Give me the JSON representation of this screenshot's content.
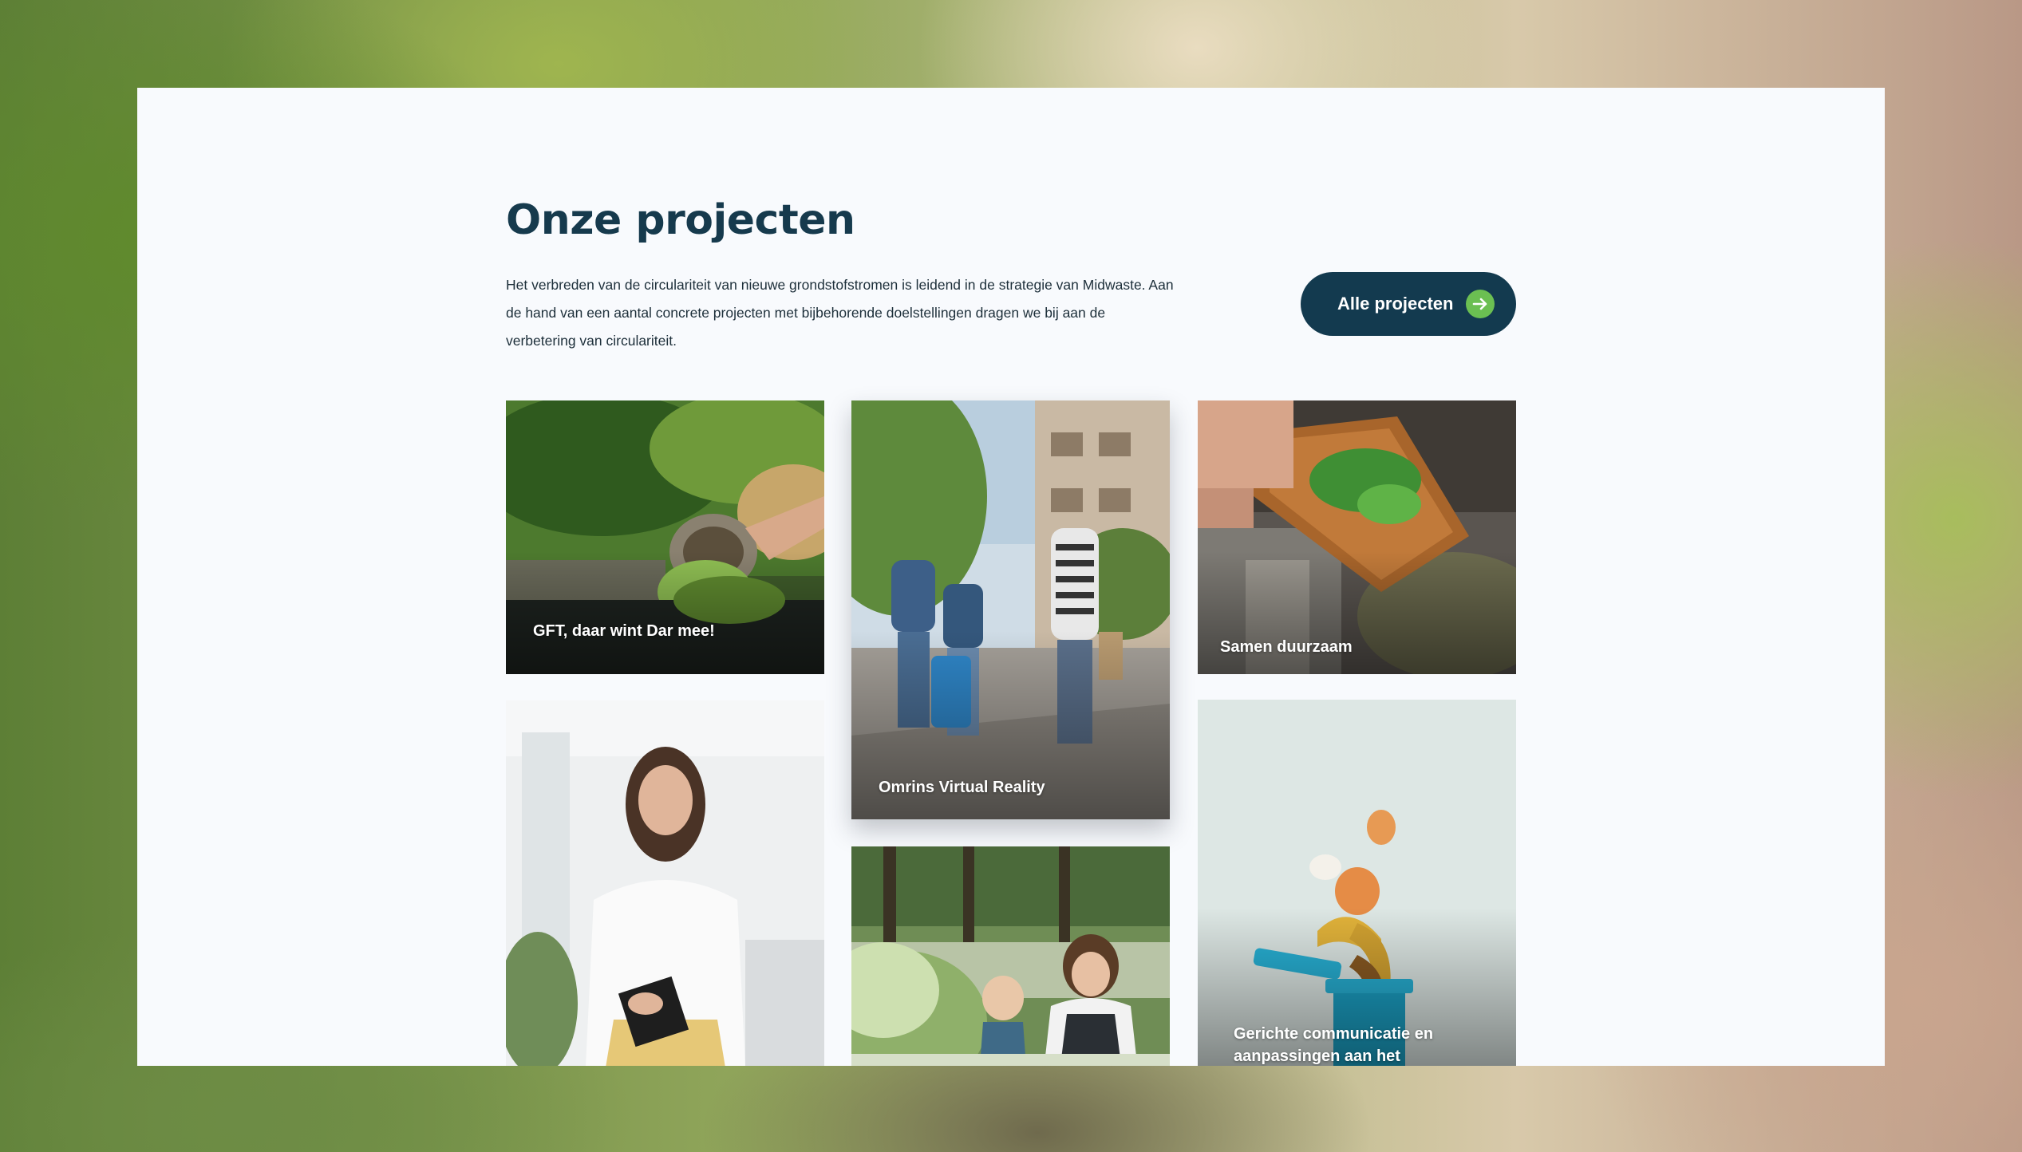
{
  "section": {
    "title": "Onze projecten",
    "intro": "Het verbreden van de circulariteit van nieuwe grondstofstromen is leidend in de strategie van Midwaste. Aan de hand van een aantal concrete projecten met bijbehorende doelstellingen dragen we bij aan de verbetering van circulariteit."
  },
  "cta": {
    "label": "Alle projecten",
    "icon": "arrow-right-icon",
    "accent": "#6bbf52",
    "bg": "#133a4f"
  },
  "projects": [
    {
      "label": "GFT, daar wint Dar mee!",
      "image": "gft-bin-photo"
    },
    {
      "label": "Omrins Virtual Reality",
      "image": "kids-walking-photo"
    },
    {
      "label": "Samen duurzaam",
      "image": "cutting-board-greens-photo"
    },
    {
      "label": "",
      "image": "smiling-woman-photo"
    },
    {
      "label": "",
      "image": "mother-child-garden-photo"
    },
    {
      "label": "Gerichte communicatie en aanpassingen aan het",
      "image": "banana-peel-bin-photo"
    }
  ],
  "colors": {
    "heading": "#163a4d",
    "text": "#1d2f3a",
    "page_bg": "#f8fafd"
  }
}
